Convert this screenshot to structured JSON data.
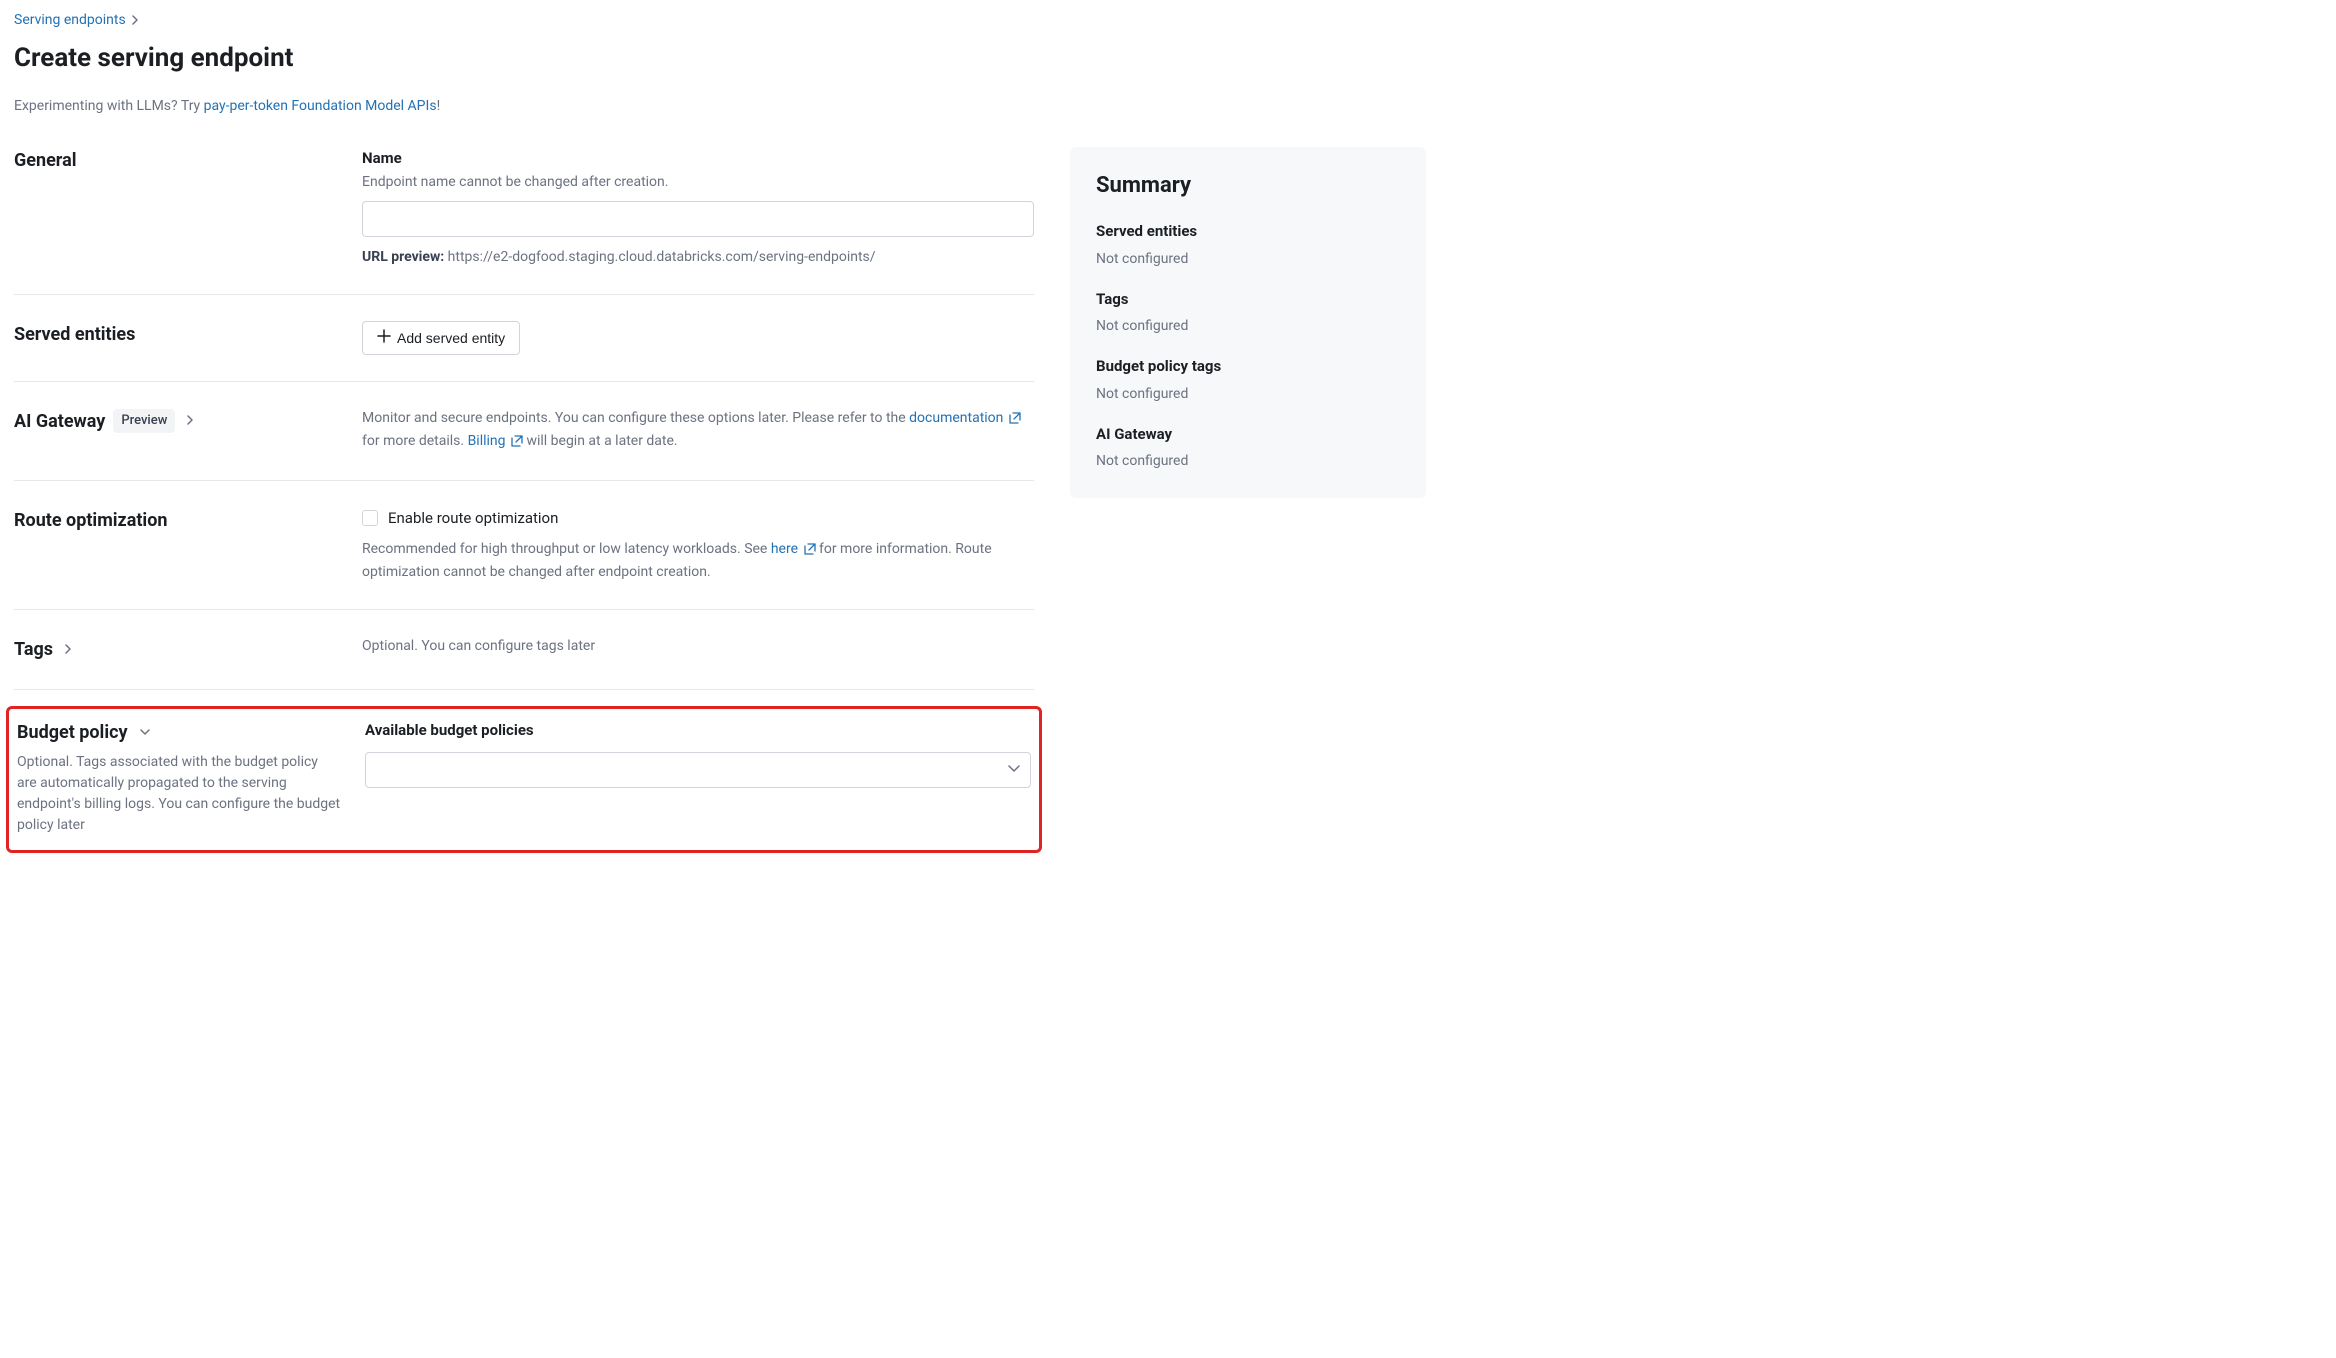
{
  "breadcrumb": {
    "link_label": "Serving endpoints"
  },
  "page_title": "Create serving endpoint",
  "helper": {
    "prefix": "Experimenting with LLMs? Try ",
    "link_label": "pay-per-token Foundation Model APIs",
    "suffix": "!"
  },
  "sections": {
    "general": {
      "title": "General",
      "name_field_label": "Name",
      "name_field_hint": "Endpoint name cannot be changed after creation.",
      "name_value": "",
      "url_preview_label": "URL preview:",
      "url_preview_value": "https://e2-dogfood.staging.cloud.databricks.com/serving-endpoints/"
    },
    "served_entities": {
      "title": "Served entities",
      "add_button_label": "Add served entity"
    },
    "ai_gateway": {
      "title": "AI Gateway",
      "badge": "Preview",
      "desc_part1": "Monitor and secure endpoints. You can configure these options later. Please refer to the ",
      "doc_link_label": "documentation",
      "desc_part2": " for more details. ",
      "billing_link_label": "Billing",
      "desc_part3": " will begin at a later date."
    },
    "route_opt": {
      "title": "Route optimization",
      "checkbox_label": "Enable route optimization",
      "desc_part1": "Recommended for high throughput or low latency workloads. See ",
      "here_link_label": "here",
      "desc_part2": " for more information. Route optimization cannot be changed after endpoint creation."
    },
    "tags": {
      "title": "Tags",
      "desc": "Optional. You can configure tags later"
    },
    "budget_policy": {
      "title": "Budget policy",
      "left_desc": "Optional. Tags associated with the budget policy are automatically propagated to the serving endpoint's billing logs. You can configure the budget policy later",
      "field_label": "Available budget policies",
      "selected_value": ""
    }
  },
  "summary": {
    "title": "Summary",
    "items": [
      {
        "label": "Served entities",
        "value": "Not configured"
      },
      {
        "label": "Tags",
        "value": "Not configured"
      },
      {
        "label": "Budget policy tags",
        "value": "Not configured"
      },
      {
        "label": "AI Gateway",
        "value": "Not configured"
      }
    ]
  }
}
